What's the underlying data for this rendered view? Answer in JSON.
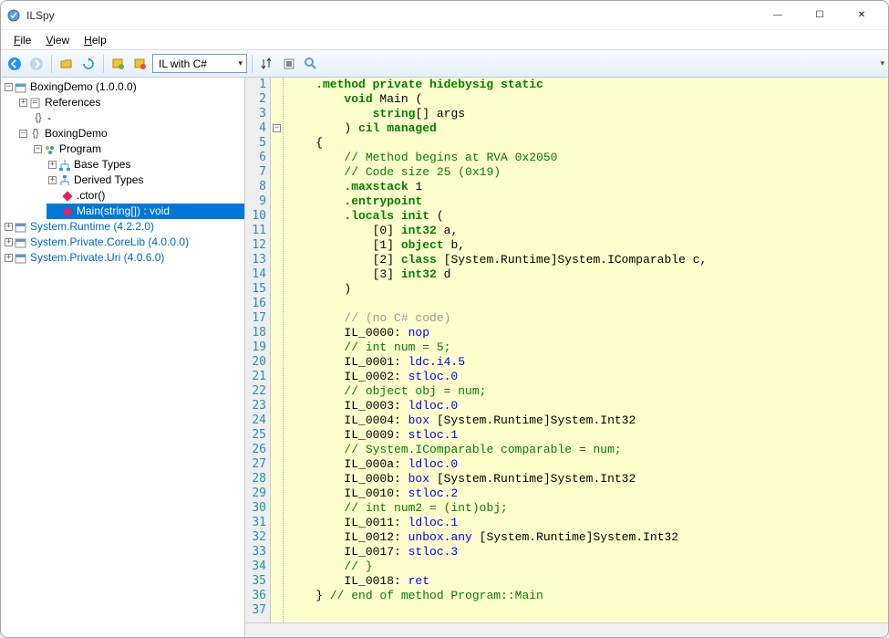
{
  "window": {
    "title": "ILSpy"
  },
  "menu": {
    "file": "File",
    "view": "View",
    "help": "Help"
  },
  "toolbar": {
    "language_dropdown": "IL with C#"
  },
  "tree": {
    "root": "BoxingDemo (1.0.0.0)",
    "references": "References",
    "dash": "-",
    "namespace": "BoxingDemo",
    "program": "Program",
    "base_types": "Base Types",
    "derived_types": "Derived Types",
    "ctor": ".ctor()",
    "main": "Main(string[]) : void",
    "runtime": "System.Runtime (4.2.2.0)",
    "corelib": "System.Private.CoreLib (4.0.0.0)",
    "uri": "System.Private.Uri (4.0.6.0)"
  },
  "code": {
    "lines": [
      {
        "n": 1,
        "segs": [
          {
            "c": "k",
            "t": "    .method private hidebysig static"
          }
        ]
      },
      {
        "n": 2,
        "segs": [
          {
            "c": "k",
            "t": "        void "
          },
          {
            "c": "nm",
            "t": "Main "
          },
          {
            "c": "op",
            "t": "("
          }
        ]
      },
      {
        "n": 3,
        "segs": [
          {
            "c": "op",
            "t": "            "
          },
          {
            "c": "k",
            "t": "string"
          },
          {
            "c": "op",
            "t": "[] "
          },
          {
            "c": "nm",
            "t": "args"
          }
        ]
      },
      {
        "n": 4,
        "segs": [
          {
            "c": "op",
            "t": "        ) "
          },
          {
            "c": "k",
            "t": "cil managed"
          }
        ]
      },
      {
        "n": 5,
        "segs": [
          {
            "c": "op",
            "t": "    {"
          }
        ]
      },
      {
        "n": 6,
        "segs": [
          {
            "c": "op",
            "t": "        "
          },
          {
            "c": "cm",
            "t": "// Method begins at RVA 0x2050"
          }
        ]
      },
      {
        "n": 7,
        "segs": [
          {
            "c": "op",
            "t": "        "
          },
          {
            "c": "cm",
            "t": "// Code size 25 (0x19)"
          }
        ]
      },
      {
        "n": 8,
        "segs": [
          {
            "c": "op",
            "t": "        "
          },
          {
            "c": "k",
            "t": ".maxstack"
          },
          {
            "c": "op",
            "t": " 1"
          }
        ]
      },
      {
        "n": 9,
        "segs": [
          {
            "c": "op",
            "t": "        "
          },
          {
            "c": "k",
            "t": ".entrypoint"
          }
        ]
      },
      {
        "n": 10,
        "segs": [
          {
            "c": "op",
            "t": "        "
          },
          {
            "c": "k",
            "t": ".locals init"
          },
          {
            "c": "op",
            "t": " ("
          }
        ]
      },
      {
        "n": 11,
        "segs": [
          {
            "c": "op",
            "t": "            [0] "
          },
          {
            "c": "k",
            "t": "int32"
          },
          {
            "c": "op",
            "t": " a,"
          }
        ]
      },
      {
        "n": 12,
        "segs": [
          {
            "c": "op",
            "t": "            [1] "
          },
          {
            "c": "k",
            "t": "object"
          },
          {
            "c": "op",
            "t": " b,"
          }
        ]
      },
      {
        "n": 13,
        "segs": [
          {
            "c": "op",
            "t": "            [2] "
          },
          {
            "c": "k",
            "t": "class"
          },
          {
            "c": "op",
            "t": " [System.Runtime]System.IComparable c,"
          }
        ]
      },
      {
        "n": 14,
        "segs": [
          {
            "c": "op",
            "t": "            [3] "
          },
          {
            "c": "k",
            "t": "int32"
          },
          {
            "c": "op",
            "t": " d"
          }
        ]
      },
      {
        "n": 15,
        "segs": [
          {
            "c": "op",
            "t": "        )"
          }
        ]
      },
      {
        "n": 16,
        "segs": [
          {
            "c": "op",
            "t": ""
          }
        ]
      },
      {
        "n": 17,
        "segs": [
          {
            "c": "op",
            "t": "        "
          },
          {
            "c": "cmg",
            "t": "// (no C# code)"
          }
        ]
      },
      {
        "n": 18,
        "segs": [
          {
            "c": "op",
            "t": "        IL_0000: "
          },
          {
            "c": "instr",
            "t": "nop"
          }
        ]
      },
      {
        "n": 19,
        "segs": [
          {
            "c": "op",
            "t": "        "
          },
          {
            "c": "cm",
            "t": "// int num = 5;"
          }
        ]
      },
      {
        "n": 20,
        "segs": [
          {
            "c": "op",
            "t": "        IL_0001: "
          },
          {
            "c": "instr",
            "t": "ldc.i4.5"
          }
        ]
      },
      {
        "n": 21,
        "segs": [
          {
            "c": "op",
            "t": "        IL_0002: "
          },
          {
            "c": "instr",
            "t": "stloc.0"
          }
        ]
      },
      {
        "n": 22,
        "segs": [
          {
            "c": "op",
            "t": "        "
          },
          {
            "c": "cm",
            "t": "// object obj = num;"
          }
        ]
      },
      {
        "n": 23,
        "segs": [
          {
            "c": "op",
            "t": "        IL_0003: "
          },
          {
            "c": "instr",
            "t": "ldloc.0"
          }
        ]
      },
      {
        "n": 24,
        "segs": [
          {
            "c": "op",
            "t": "        IL_0004: "
          },
          {
            "c": "instr",
            "t": "box"
          },
          {
            "c": "op",
            "t": " [System.Runtime]System.Int32"
          }
        ]
      },
      {
        "n": 25,
        "segs": [
          {
            "c": "op",
            "t": "        IL_0009: "
          },
          {
            "c": "instr",
            "t": "stloc.1"
          }
        ]
      },
      {
        "n": 26,
        "segs": [
          {
            "c": "op",
            "t": "        "
          },
          {
            "c": "cm",
            "t": "// System.IComparable comparable = num;"
          }
        ]
      },
      {
        "n": 27,
        "segs": [
          {
            "c": "op",
            "t": "        IL_000a: "
          },
          {
            "c": "instr",
            "t": "ldloc.0"
          }
        ]
      },
      {
        "n": 28,
        "segs": [
          {
            "c": "op",
            "t": "        IL_000b: "
          },
          {
            "c": "instr",
            "t": "box"
          },
          {
            "c": "op",
            "t": " [System.Runtime]System.Int32"
          }
        ]
      },
      {
        "n": 29,
        "segs": [
          {
            "c": "op",
            "t": "        IL_0010: "
          },
          {
            "c": "instr",
            "t": "stloc.2"
          }
        ]
      },
      {
        "n": 30,
        "segs": [
          {
            "c": "op",
            "t": "        "
          },
          {
            "c": "cm",
            "t": "// int num2 = (int)obj;"
          }
        ]
      },
      {
        "n": 31,
        "segs": [
          {
            "c": "op",
            "t": "        IL_0011: "
          },
          {
            "c": "instr",
            "t": "ldloc.1"
          }
        ]
      },
      {
        "n": 32,
        "segs": [
          {
            "c": "op",
            "t": "        IL_0012: "
          },
          {
            "c": "instr",
            "t": "unbox"
          },
          {
            "c": "op",
            "t": "."
          },
          {
            "c": "instr",
            "t": "any"
          },
          {
            "c": "op",
            "t": " [System.Runtime]System.Int32"
          }
        ]
      },
      {
        "n": 33,
        "segs": [
          {
            "c": "op",
            "t": "        IL_0017: "
          },
          {
            "c": "instr",
            "t": "stloc.3"
          }
        ]
      },
      {
        "n": 34,
        "segs": [
          {
            "c": "op",
            "t": "        "
          },
          {
            "c": "cm",
            "t": "// }"
          }
        ]
      },
      {
        "n": 35,
        "segs": [
          {
            "c": "op",
            "t": "        IL_0018: "
          },
          {
            "c": "instr",
            "t": "ret"
          }
        ]
      },
      {
        "n": 36,
        "segs": [
          {
            "c": "op",
            "t": "    } "
          },
          {
            "c": "cm",
            "t": "// end of method Program::Main"
          }
        ]
      },
      {
        "n": 37,
        "segs": [
          {
            "c": "op",
            "t": ""
          }
        ]
      }
    ]
  }
}
